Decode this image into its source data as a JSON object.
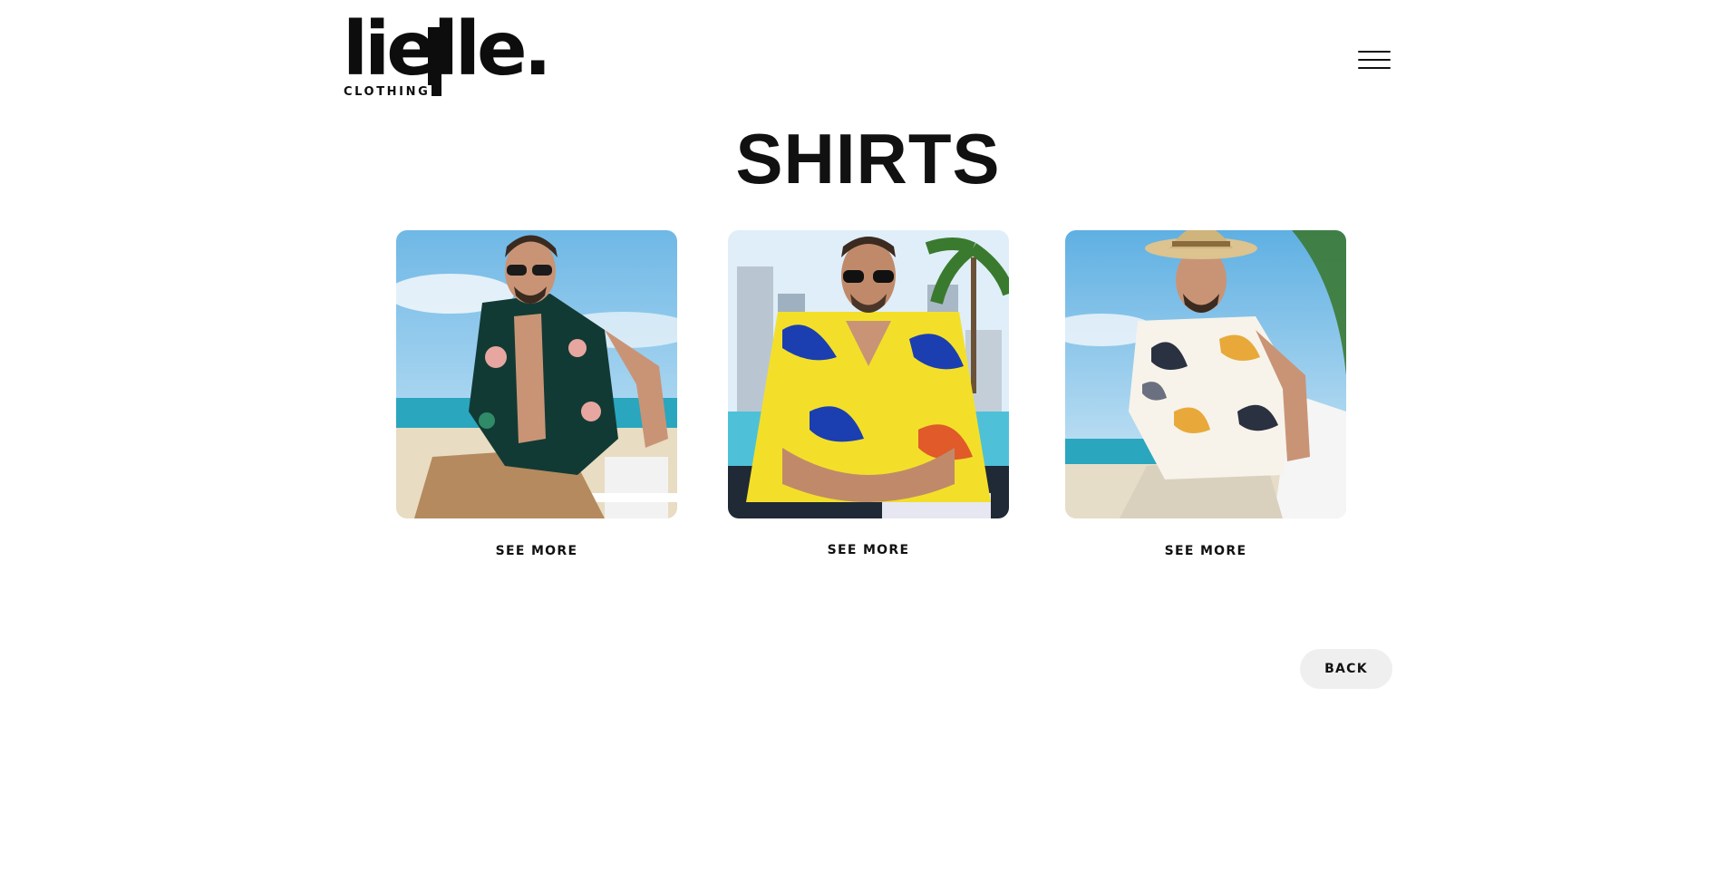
{
  "header": {
    "logo_word": "lielle.",
    "logo_sub": "CLOTHING",
    "menu_icon": "hamburger-menu-icon"
  },
  "page": {
    "title": "SHIRTS"
  },
  "products": [
    {
      "image": "man-in-green-floral-hawaiian-shirt-at-beach",
      "link_label": "SEE MORE"
    },
    {
      "image": "man-in-yellow-blue-leaf-hawaiian-shirt-by-pool",
      "link_label": "SEE MORE"
    },
    {
      "image": "man-in-white-palm-print-shirt-with-straw-hat",
      "link_label": "SEE MORE"
    }
  ],
  "footer": {
    "back_label": "BACK"
  },
  "colors": {
    "text": "#111111",
    "back_button_bg": "#efefef",
    "background": "#ffffff"
  }
}
